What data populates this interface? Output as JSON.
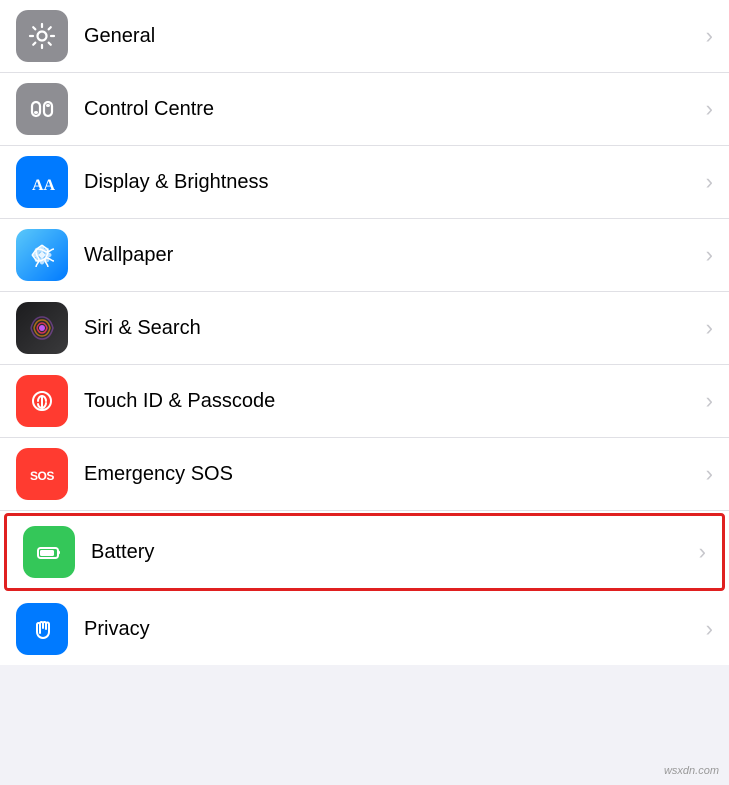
{
  "settings": {
    "items": [
      {
        "id": "general",
        "label": "General",
        "icon_type": "gear",
        "icon_bg": "icon-gray",
        "highlighted": false
      },
      {
        "id": "control-centre",
        "label": "Control Centre",
        "icon_type": "toggle",
        "icon_bg": "icon-gray",
        "highlighted": false
      },
      {
        "id": "display-brightness",
        "label": "Display & Brightness",
        "icon_type": "aa",
        "icon_bg": "icon-blue",
        "highlighted": false
      },
      {
        "id": "wallpaper",
        "label": "Wallpaper",
        "icon_type": "flower",
        "icon_bg": "icon-teal",
        "highlighted": false
      },
      {
        "id": "siri-search",
        "label": "Siri & Search",
        "icon_type": "siri",
        "icon_bg": "icon-black-gradient",
        "highlighted": false
      },
      {
        "id": "touch-id",
        "label": "Touch ID & Passcode",
        "icon_type": "fingerprint",
        "icon_bg": "icon-red",
        "highlighted": false
      },
      {
        "id": "emergency-sos",
        "label": "Emergency SOS",
        "icon_type": "sos",
        "icon_bg": "icon-red",
        "highlighted": false
      },
      {
        "id": "battery",
        "label": "Battery",
        "icon_type": "battery",
        "icon_bg": "icon-green",
        "highlighted": true
      },
      {
        "id": "privacy",
        "label": "Privacy",
        "icon_type": "hand",
        "icon_bg": "icon-blue-hand",
        "highlighted": false
      }
    ]
  },
  "watermark": "wsxdn.com"
}
